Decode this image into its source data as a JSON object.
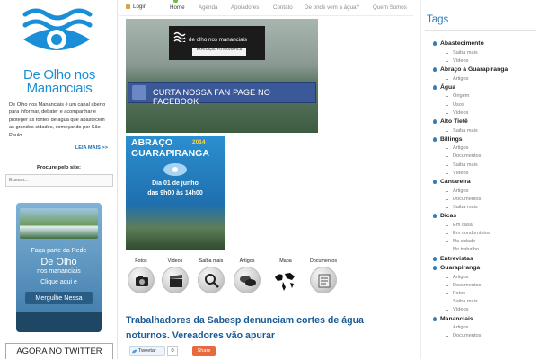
{
  "brand": {
    "line1": "De Olho nos",
    "line2": "Mananciais"
  },
  "about": {
    "text": "De Olho nos Mananciais é um canal aberto para informar, debater e acompanhar e proteger as fontes de água que abastecem as grandes cidades, começando por São Paulo.",
    "read_more": "LEIA MAIS >>"
  },
  "search": {
    "label": "Procure pelo site:",
    "placeholder": "Buscar..."
  },
  "promo": {
    "line1": "Faça parte da Rede",
    "line2": "De Olho",
    "line3": "nos mananciais",
    "line4": "Clique aqui e",
    "button": "Mergulhe Nessa"
  },
  "twitter": {
    "label": "AGORA NO TWITTER"
  },
  "nav": {
    "login": "Login",
    "items": [
      "Home",
      "Agenda",
      "Apoiadores",
      "Contato",
      "De onde vem a água?",
      "Quem Somos"
    ]
  },
  "banner1": {
    "title": "de olho nos mananciais",
    "subtitle": "EXPEDIÇÃO FOTOGRÁFICA",
    "cta": "CURTA NOSSA FAN PAGE NO FACEBOOK"
  },
  "banner2": {
    "title_a": "ABRAÇO",
    "year": "2014",
    "title_b": "GUARAPIRANGA",
    "date1": "Dia 01 de junho",
    "date2": "das 9h00 às 14h00"
  },
  "icon_row": [
    {
      "label": "Fotos",
      "icon": "camera-icon"
    },
    {
      "label": "Vídeos",
      "icon": "clapperboard-icon"
    },
    {
      "label": "Saiba mais",
      "icon": "magnifier-icon"
    },
    {
      "label": "Artigos",
      "icon": "speech-bubbles-icon"
    },
    {
      "label": "Mapa",
      "icon": "globe-icon"
    },
    {
      "label": "Documentos",
      "icon": "document-icon"
    }
  ],
  "article": {
    "headline": "Trabalhadores da Sabesp denunciam cortes de água noturnos. Vereadores vão apurar",
    "tweet_label": "Tweetar",
    "tweet_count": "0",
    "share_label": "Share"
  },
  "tags": {
    "title": "Tags",
    "groups": [
      {
        "name": "Abastecimento",
        "subs": [
          "Saiba mais",
          "Vídeos"
        ]
      },
      {
        "name": "Abraço à Guarapiranga",
        "subs": [
          "Artigos"
        ]
      },
      {
        "name": "Água",
        "subs": [
          "Origem",
          "Usos",
          "Vídeos"
        ]
      },
      {
        "name": "Alto Tietê",
        "subs": [
          "Saiba mais"
        ]
      },
      {
        "name": "Billings",
        "subs": [
          "Artigos",
          "Documentos",
          "Saiba mais",
          "Vídeos"
        ]
      },
      {
        "name": "Cantareira",
        "subs": [
          "Artigos",
          "Documentos",
          "Saiba mais"
        ]
      },
      {
        "name": "Dicas",
        "subs": [
          "Em casa",
          "Em condomínios",
          "Na cidade",
          "No trabalho"
        ]
      },
      {
        "name": "Entrevistas",
        "subs": []
      },
      {
        "name": "Guarapiranga",
        "subs": [
          "Artigos",
          "Documentos",
          "Fotos",
          "Saiba mais",
          "Vídeos"
        ]
      },
      {
        "name": "Mananciais",
        "subs": [
          "Artigos",
          "Documentos"
        ]
      }
    ]
  },
  "colors": {
    "accent": "#1a8ed6",
    "link": "#1a5b96",
    "facebook": "#3b5998",
    "share": "#e8693d"
  }
}
